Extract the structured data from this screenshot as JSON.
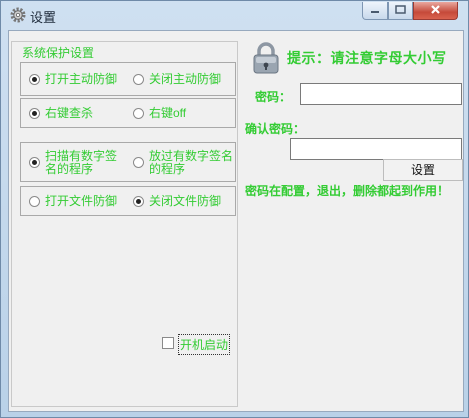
{
  "window": {
    "title": "设置"
  },
  "group": {
    "title": "系统保护设置",
    "rows": [
      {
        "left": {
          "label": "打开主动防御",
          "selected": true
        },
        "right": {
          "label": "关闭主动防御",
          "selected": false
        }
      },
      {
        "left": {
          "label": "右键查杀",
          "selected": true
        },
        "right": {
          "label": "右键off",
          "selected": false
        }
      },
      {
        "left": {
          "label": "扫描有数字签名的程序",
          "selected": true
        },
        "right": {
          "label": "放过有数字签名的程序",
          "selected": false
        }
      },
      {
        "left": {
          "label": "打开文件防御",
          "selected": false
        },
        "right": {
          "label": "关闭文件防御",
          "selected": true
        }
      }
    ]
  },
  "autostart": {
    "label": "开机启动",
    "checked": false
  },
  "hint": "提示：请注意字母大小写",
  "password": {
    "label": "密码：",
    "value": ""
  },
  "confirm": {
    "label": "确认密码：",
    "value": ""
  },
  "set_button": "设置",
  "note": "密码在配置，退出，删除都起到作用！",
  "colors": {
    "accent": "#33cc33"
  }
}
